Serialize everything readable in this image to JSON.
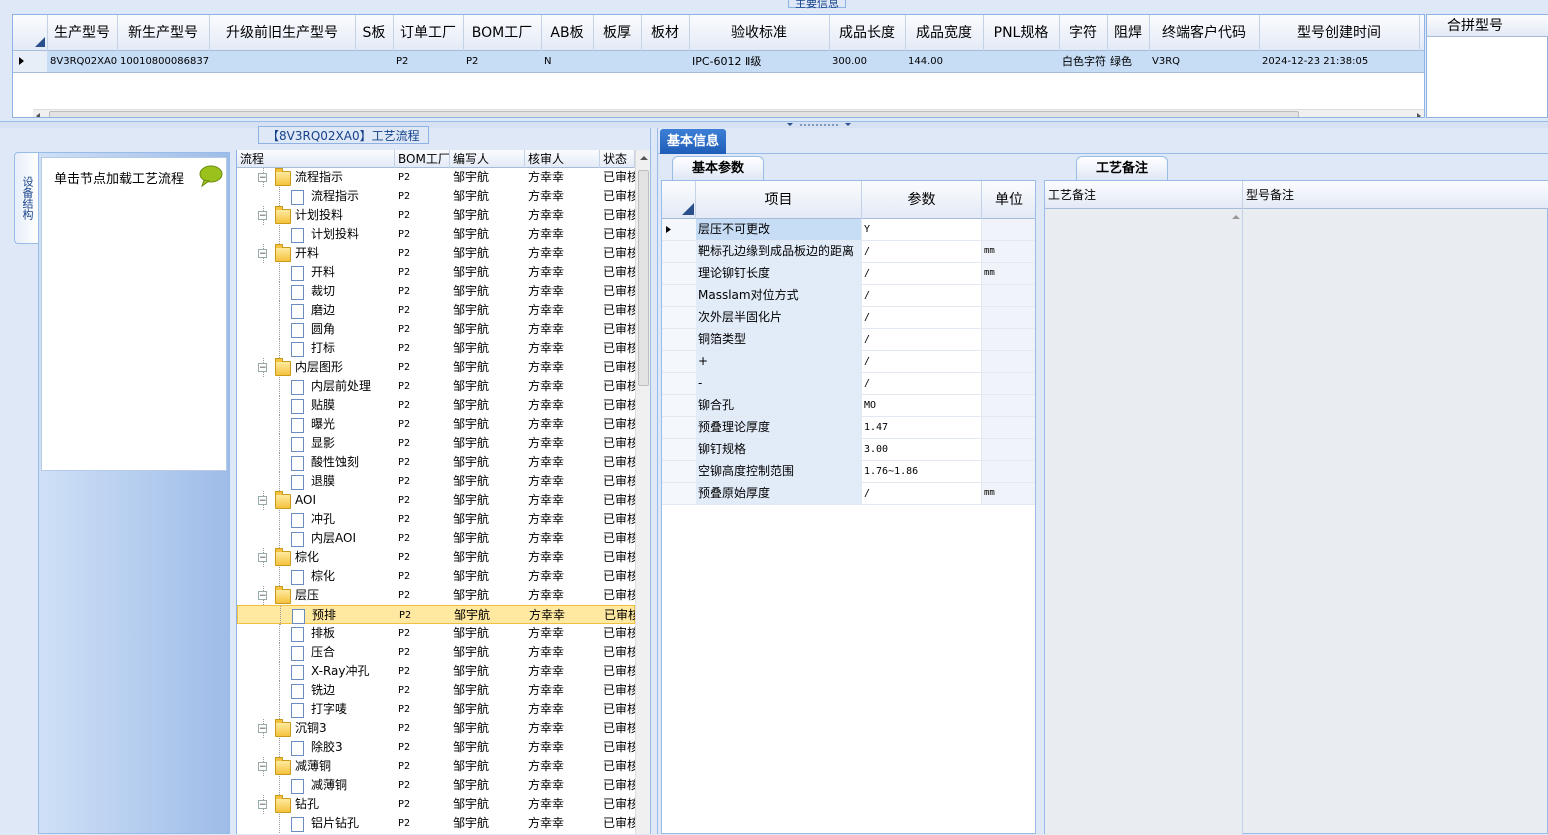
{
  "top_section": {
    "legend": "主要信息",
    "columns": [
      "生产型号",
      "新生产型号",
      "升级前旧生产型号",
      "S板",
      "订单工厂",
      "BOM工厂",
      "AB板",
      "板厚",
      "板材",
      "验收标准",
      "成品长度",
      "成品宽度",
      "PNL规格",
      "字符",
      "阻焊",
      "终端客户代码",
      "型号创建时间"
    ],
    "row": {
      "production_model": "8V3RQ02XA0",
      "new_production_model": "10010800086837",
      "old_model": "",
      "s_board": "",
      "order_factory": "P2",
      "bom_factory": "P2",
      "ab_board": "N",
      "thickness": "",
      "material": "",
      "acceptance_standard": "IPC-6012 Ⅱ级",
      "finished_length": "300.00",
      "finished_width": "144.00",
      "pnl_spec": "",
      "character": "白色字符",
      "solder_mask": "绿色",
      "customer_code": "V3RQ",
      "created_time": "2024-12-23 21:38:05"
    },
    "merge_header": "合拼型号"
  },
  "left_panel": {
    "vertical_tab": "设备结构",
    "tip_text": "单击节点加载工艺流程"
  },
  "tree_section": {
    "legend": "【8V3RQ02XA0】工艺流程",
    "columns": [
      "流程",
      "BOM工厂",
      "编写人",
      "核审人",
      "状态"
    ],
    "rows": [
      {
        "name": "流程指示",
        "level": 0,
        "type": "folder",
        "bom": "P2",
        "writer": "邹宇航",
        "reviewer": "方幸幸",
        "status": "已审核"
      },
      {
        "name": "流程指示",
        "level": 1,
        "type": "doc",
        "bom": "P2",
        "writer": "邹宇航",
        "reviewer": "方幸幸",
        "status": "已审核"
      },
      {
        "name": "计划投料",
        "level": 0,
        "type": "folder",
        "bom": "P2",
        "writer": "邹宇航",
        "reviewer": "方幸幸",
        "status": "已审核"
      },
      {
        "name": "计划投料",
        "level": 1,
        "type": "doc",
        "bom": "P2",
        "writer": "邹宇航",
        "reviewer": "方幸幸",
        "status": "已审核"
      },
      {
        "name": "开料",
        "level": 0,
        "type": "folder",
        "bom": "P2",
        "writer": "邹宇航",
        "reviewer": "方幸幸",
        "status": "已审核"
      },
      {
        "name": "开料",
        "level": 1,
        "type": "doc",
        "bom": "P2",
        "writer": "邹宇航",
        "reviewer": "方幸幸",
        "status": "已审核"
      },
      {
        "name": "裁切",
        "level": 1,
        "type": "doc",
        "bom": "P2",
        "writer": "邹宇航",
        "reviewer": "方幸幸",
        "status": "已审核"
      },
      {
        "name": "磨边",
        "level": 1,
        "type": "doc",
        "bom": "P2",
        "writer": "邹宇航",
        "reviewer": "方幸幸",
        "status": "已审核"
      },
      {
        "name": "圆角",
        "level": 1,
        "type": "doc",
        "bom": "P2",
        "writer": "邹宇航",
        "reviewer": "方幸幸",
        "status": "已审核"
      },
      {
        "name": "打标",
        "level": 1,
        "type": "doc",
        "bom": "P2",
        "writer": "邹宇航",
        "reviewer": "方幸幸",
        "status": "已审核"
      },
      {
        "name": "内层图形",
        "level": 0,
        "type": "folder",
        "bom": "P2",
        "writer": "邹宇航",
        "reviewer": "方幸幸",
        "status": "已审核"
      },
      {
        "name": "内层前处理",
        "level": 1,
        "type": "doc",
        "bom": "P2",
        "writer": "邹宇航",
        "reviewer": "方幸幸",
        "status": "已审核"
      },
      {
        "name": "贴膜",
        "level": 1,
        "type": "doc",
        "bom": "P2",
        "writer": "邹宇航",
        "reviewer": "方幸幸",
        "status": "已审核"
      },
      {
        "name": "曝光",
        "level": 1,
        "type": "doc",
        "bom": "P2",
        "writer": "邹宇航",
        "reviewer": "方幸幸",
        "status": "已审核"
      },
      {
        "name": "显影",
        "level": 1,
        "type": "doc",
        "bom": "P2",
        "writer": "邹宇航",
        "reviewer": "方幸幸",
        "status": "已审核"
      },
      {
        "name": "酸性蚀刻",
        "level": 1,
        "type": "doc",
        "bom": "P2",
        "writer": "邹宇航",
        "reviewer": "方幸幸",
        "status": "已审核"
      },
      {
        "name": "退膜",
        "level": 1,
        "type": "doc",
        "bom": "P2",
        "writer": "邹宇航",
        "reviewer": "方幸幸",
        "status": "已审核"
      },
      {
        "name": "AOI",
        "level": 0,
        "type": "folder",
        "bom": "P2",
        "writer": "邹宇航",
        "reviewer": "方幸幸",
        "status": "已审核"
      },
      {
        "name": "冲孔",
        "level": 1,
        "type": "doc",
        "bom": "P2",
        "writer": "邹宇航",
        "reviewer": "方幸幸",
        "status": "已审核"
      },
      {
        "name": "内层AOI",
        "level": 1,
        "type": "doc",
        "bom": "P2",
        "writer": "邹宇航",
        "reviewer": "方幸幸",
        "status": "已审核"
      },
      {
        "name": "棕化",
        "level": 0,
        "type": "folder",
        "bom": "P2",
        "writer": "邹宇航",
        "reviewer": "方幸幸",
        "status": "已审核"
      },
      {
        "name": "棕化",
        "level": 1,
        "type": "doc",
        "bom": "P2",
        "writer": "邹宇航",
        "reviewer": "方幸幸",
        "status": "已审核"
      },
      {
        "name": "层压",
        "level": 0,
        "type": "folder",
        "bom": "P2",
        "writer": "邹宇航",
        "reviewer": "方幸幸",
        "status": "已审核"
      },
      {
        "name": "预排",
        "level": 1,
        "type": "doc",
        "bom": "P2",
        "writer": "邹宇航",
        "reviewer": "方幸幸",
        "status": "已审核",
        "selected": true
      },
      {
        "name": "排板",
        "level": 1,
        "type": "doc",
        "bom": "P2",
        "writer": "邹宇航",
        "reviewer": "方幸幸",
        "status": "已审核"
      },
      {
        "name": "压合",
        "level": 1,
        "type": "doc",
        "bom": "P2",
        "writer": "邹宇航",
        "reviewer": "方幸幸",
        "status": "已审核"
      },
      {
        "name": "X-Ray冲孔",
        "level": 1,
        "type": "doc",
        "bom": "P2",
        "writer": "邹宇航",
        "reviewer": "方幸幸",
        "status": "已审核"
      },
      {
        "name": "铣边",
        "level": 1,
        "type": "doc",
        "bom": "P2",
        "writer": "邹宇航",
        "reviewer": "方幸幸",
        "status": "已审核"
      },
      {
        "name": "打字唛",
        "level": 1,
        "type": "doc",
        "bom": "P2",
        "writer": "邹宇航",
        "reviewer": "方幸幸",
        "status": "已审核"
      },
      {
        "name": "沉铜3",
        "level": 0,
        "type": "folder",
        "bom": "P2",
        "writer": "邹宇航",
        "reviewer": "方幸幸",
        "status": "已审核"
      },
      {
        "name": "除胶3",
        "level": 1,
        "type": "doc",
        "bom": "P2",
        "writer": "邹宇航",
        "reviewer": "方幸幸",
        "status": "已审核"
      },
      {
        "name": "减薄铜",
        "level": 0,
        "type": "folder",
        "bom": "P2",
        "writer": "邹宇航",
        "reviewer": "方幸幸",
        "status": "已审核"
      },
      {
        "name": "减薄铜",
        "level": 1,
        "type": "doc",
        "bom": "P2",
        "writer": "邹宇航",
        "reviewer": "方幸幸",
        "status": "已审核"
      },
      {
        "name": "钻孔",
        "level": 0,
        "type": "folder",
        "bom": "P2",
        "writer": "邹宇航",
        "reviewer": "方幸幸",
        "status": "已审核"
      },
      {
        "name": "铝片钻孔",
        "level": 1,
        "type": "doc",
        "bom": "P2",
        "writer": "邹宇航",
        "reviewer": "方幸幸",
        "status": "已审核"
      }
    ]
  },
  "basic_info": {
    "tab_label": "基本信息",
    "sub_tab": "基本参数",
    "columns": [
      "项目",
      "参数",
      "单位"
    ],
    "rows": [
      {
        "item": "层压不可更改",
        "param": "Y",
        "unit": "",
        "selected": true
      },
      {
        "item": "靶标孔边缘到成品板边的距离",
        "param": "/",
        "unit": "mm"
      },
      {
        "item": "理论铆钉长度",
        "param": "/",
        "unit": "mm"
      },
      {
        "item": "Masslam对位方式",
        "param": "/",
        "unit": ""
      },
      {
        "item": "次外层半固化片",
        "param": "/",
        "unit": ""
      },
      {
        "item": "铜箔类型",
        "param": "/",
        "unit": ""
      },
      {
        "item": "+",
        "param": "/",
        "unit": ""
      },
      {
        "item": "-",
        "param": "/",
        "unit": ""
      },
      {
        "item": "铆合孔",
        "param": "MO",
        "unit": ""
      },
      {
        "item": "预叠理论厚度",
        "param": "1.47",
        "unit": ""
      },
      {
        "item": "铆钉规格",
        "param": "3.00",
        "unit": ""
      },
      {
        "item": "空铆高度控制范围",
        "param": "1.76~1.86",
        "unit": ""
      },
      {
        "item": "预叠原始厚度",
        "param": "/",
        "unit": "mm"
      }
    ]
  },
  "craft_notes": {
    "tab_label": "工艺备注",
    "columns": [
      "工艺备注",
      "型号备注"
    ]
  }
}
